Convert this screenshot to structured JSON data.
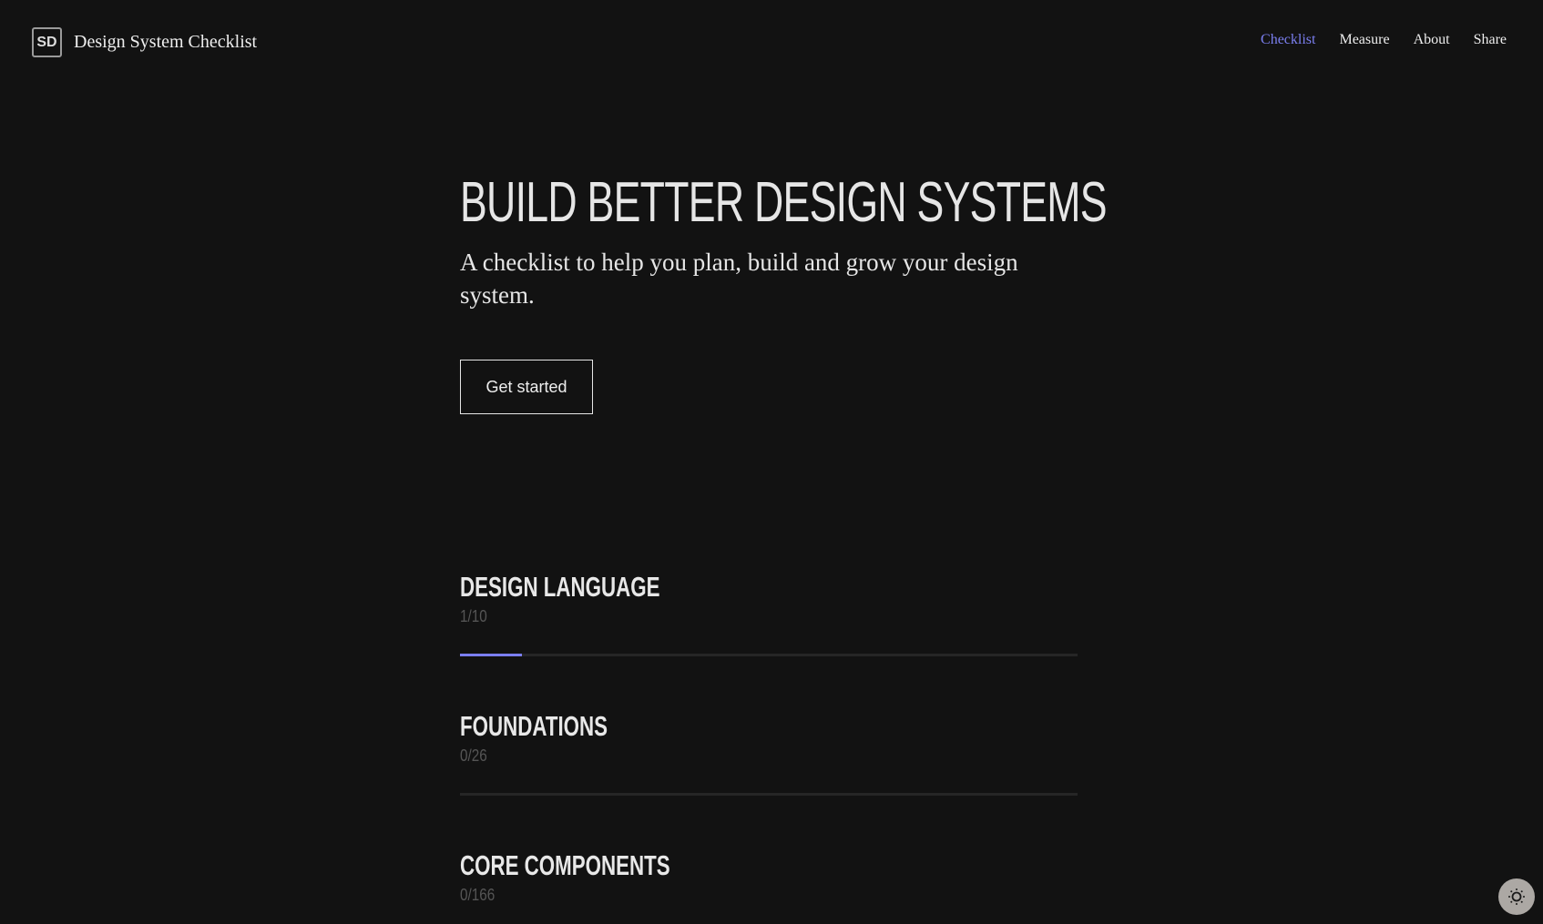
{
  "header": {
    "logo_mark": "SD",
    "title": "Design System Checklist"
  },
  "nav": [
    {
      "label": "Checklist",
      "active": true
    },
    {
      "label": "Measure"
    },
    {
      "label": "About"
    },
    {
      "label": "Share"
    }
  ],
  "hero": {
    "title": "BUILD BETTER DESIGN SYSTEMS",
    "subtitle": "A checklist to help you plan, build and grow your design system.",
    "cta": "Get started"
  },
  "sections": [
    {
      "title": "DESIGN LANGUAGE",
      "count": "1/10",
      "progress": 0.1
    },
    {
      "title": "FOUNDATIONS",
      "count": "0/26",
      "progress": 0
    },
    {
      "title": "CORE COMPONENTS",
      "count": "0/166",
      "progress": 0
    }
  ],
  "colors": {
    "accent": "#7b7ff0",
    "background": "#121212"
  },
  "theme_toggle": {
    "icon": "sun-icon"
  }
}
